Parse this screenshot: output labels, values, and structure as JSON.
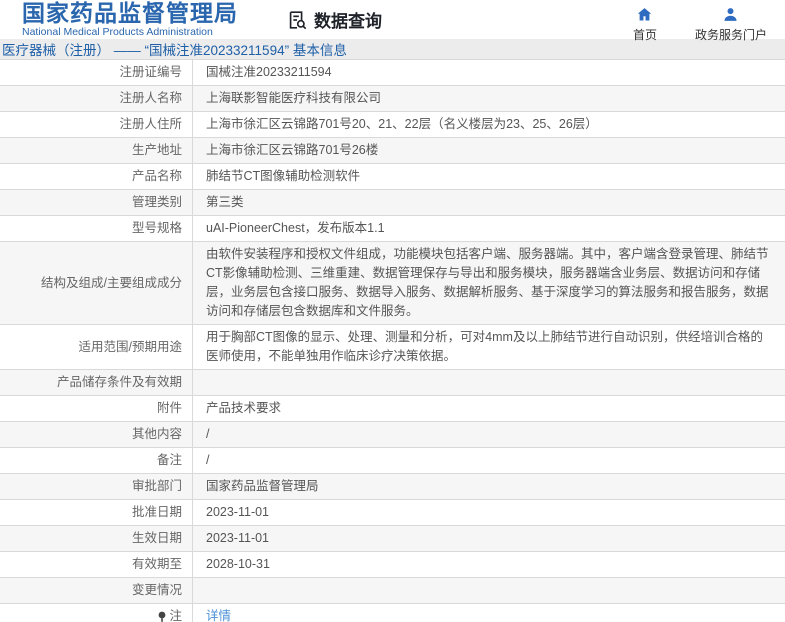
{
  "header": {
    "logo_title": "国家药品监督管理局",
    "logo_subtitle": "National Medical Products Administration",
    "section_title": "数据查询",
    "nav_home": "首页",
    "nav_portal": "政务服务门户"
  },
  "breadcrumb": {
    "text": "医疗器械（注册） —— “国械注准20233211594” 基本信息"
  },
  "colors": {
    "brand_blue": "#2a66ae",
    "divider_blue": "#2e5f96",
    "breadcrumb_text": "#1e5fa8",
    "link_blue": "#4a90d6",
    "row_alt_bg": "#f6f6f6",
    "border_gray": "#d9d9d9"
  },
  "table": {
    "rows": [
      {
        "label": "注册证编号",
        "value": "国械注准20233211594"
      },
      {
        "label": "注册人名称",
        "value": "上海联影智能医疗科技有限公司"
      },
      {
        "label": "注册人住所",
        "value": "上海市徐汇区云锦路701号20、21、22层（名义楼层为23、25、26层）"
      },
      {
        "label": "生产地址",
        "value": "上海市徐汇区云锦路701号26楼"
      },
      {
        "label": "产品名称",
        "value": "肺结节CT图像辅助检测软件"
      },
      {
        "label": "管理类别",
        "value": "第三类"
      },
      {
        "label": "型号规格",
        "value": "uAI-PioneerChest，发布版本1.1"
      },
      {
        "label": "结构及组成/主要组成成分",
        "value": "由软件安装程序和授权文件组成，功能模块包括客户端、服务器端。其中，客户端含登录管理、肺结节CT影像辅助检测、三维重建、数据管理保存与导出和服务模块，服务器端含业务层、数据访问和存储层，业务层包含接口服务、数据导入服务、数据解析服务、基于深度学习的算法服务和报告服务，数据访问和存储层包含数据库和文件服务。"
      },
      {
        "label": "适用范围/预期用途",
        "value": "用于胸部CT图像的显示、处理、测量和分析，可对4mm及以上肺结节进行自动识别，供经培训合格的医师使用，不能单独用作临床诊疗决策依据。"
      },
      {
        "label": "产品储存条件及有效期",
        "value": ""
      },
      {
        "label": "附件",
        "value": "产品技术要求"
      },
      {
        "label": "其他内容",
        "value": "/"
      },
      {
        "label": "备注",
        "value": "/"
      },
      {
        "label": "审批部门",
        "value": "国家药品监督管理局"
      },
      {
        "label": "批准日期",
        "value": "2023-11-01"
      },
      {
        "label": "生效日期",
        "value": "2023-11-01"
      },
      {
        "label": "有效期至",
        "value": "2028-10-31"
      },
      {
        "label": "变更情况",
        "value": ""
      },
      {
        "label": "注",
        "value": "详情"
      }
    ]
  }
}
